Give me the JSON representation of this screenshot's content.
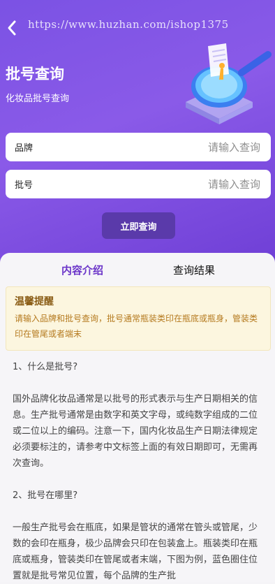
{
  "nav": {
    "back_icon": "chevron-left-icon",
    "watermark": "https://www.huzhan.com/ishop1375"
  },
  "header": {
    "title": "批号查询",
    "subtitle": "化妆品批号查询"
  },
  "form": {
    "brand_label": "品牌",
    "brand_placeholder": "请输入查询",
    "batch_label": "批号",
    "batch_placeholder": "请输入查询",
    "submit_label": "立即查询"
  },
  "tabs": {
    "intro": "内容介绍",
    "result": "查询结果"
  },
  "notice": {
    "title": "温馨提醒",
    "body": "请输入品牌和批号查询，批号通常瓶装类印在瓶底或瓶身，管装类印在管尾或者端末"
  },
  "content": {
    "q1": "1、什么是批号?",
    "a1": "国外品牌化妆品通常是以批号的形式表示与生产日期相关的信息。生产批号通常是由数字和英文字母，或纯数字组成的二位或二位以上的编码。注意一下，国内化妆品生产日期法律规定必须要标注的，请参考中文标签上面的有效日期即可，无需再次查询。",
    "q2": "2、批号在哪里?",
    "a2": "一般生产批号会在瓶底，如果是管状的通常在管头或管尾，少数的会印在瓶身，极少品牌会只印在包装盒上。瓶装类印在瓶底或瓶身，管装类印在管尾或者末端，下图为例，蓝色圈住位置就是批号常见位置，每个品牌的生产批"
  },
  "colors": {
    "header_start": "#7b52e4",
    "header_end": "#6f3fd6",
    "button": "#5a3aaa",
    "tab_active": "#6b35c9",
    "notice_bg": "#fcf6df",
    "notice_text": "#b57a1f"
  }
}
